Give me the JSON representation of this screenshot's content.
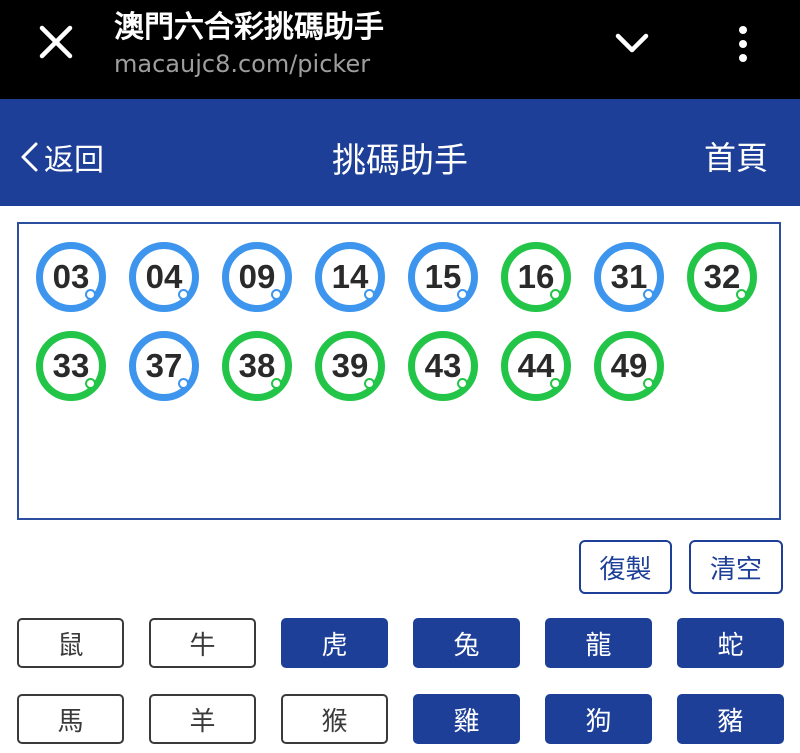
{
  "browser": {
    "title": "澳門六合彩挑碼助手",
    "url": "macaujc8.com/picker"
  },
  "nav": {
    "back_label": "返回",
    "title": "挑碼助手",
    "home_label": "首頁"
  },
  "picked": [
    {
      "number": "03",
      "color": "blue"
    },
    {
      "number": "04",
      "color": "blue"
    },
    {
      "number": "09",
      "color": "blue"
    },
    {
      "number": "14",
      "color": "blue"
    },
    {
      "number": "15",
      "color": "blue"
    },
    {
      "number": "16",
      "color": "green"
    },
    {
      "number": "31",
      "color": "blue"
    },
    {
      "number": "32",
      "color": "green"
    },
    {
      "number": "33",
      "color": "green"
    },
    {
      "number": "37",
      "color": "blue"
    },
    {
      "number": "38",
      "color": "green"
    },
    {
      "number": "39",
      "color": "green"
    },
    {
      "number": "43",
      "color": "green"
    },
    {
      "number": "44",
      "color": "green"
    },
    {
      "number": "49",
      "color": "green"
    }
  ],
  "actions": {
    "copy_label": "復製",
    "clear_label": "清空"
  },
  "zodiacs": [
    {
      "label": "鼠",
      "selected": false
    },
    {
      "label": "牛",
      "selected": false
    },
    {
      "label": "虎",
      "selected": true
    },
    {
      "label": "兔",
      "selected": true
    },
    {
      "label": "龍",
      "selected": true
    },
    {
      "label": "蛇",
      "selected": true
    },
    {
      "label": "馬",
      "selected": false
    },
    {
      "label": "羊",
      "selected": false
    },
    {
      "label": "猴",
      "selected": false
    },
    {
      "label": "雞",
      "selected": true
    },
    {
      "label": "狗",
      "selected": true
    },
    {
      "label": "豬",
      "selected": true
    }
  ],
  "colors": {
    "brand_blue": "#1d3f98",
    "ball_blue": "#3d95ee",
    "ball_green": "#23c548"
  }
}
